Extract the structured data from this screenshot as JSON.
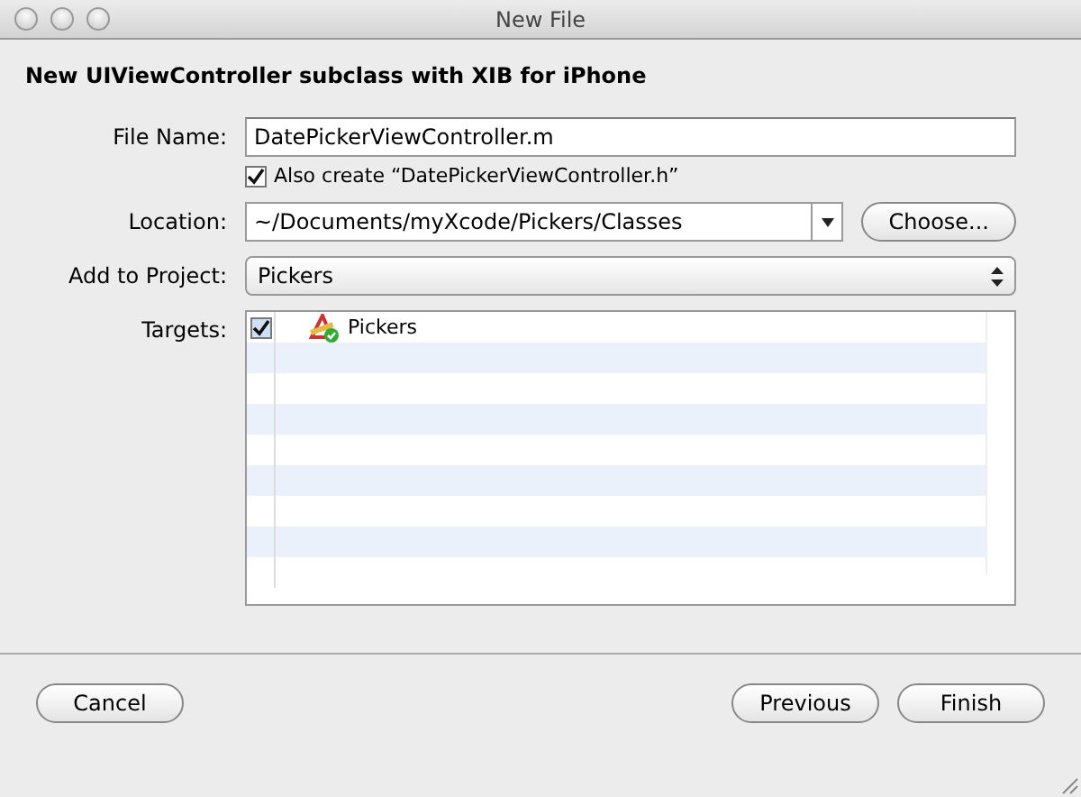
{
  "window": {
    "title": "New File"
  },
  "heading": "New UIViewController subclass with XIB for iPhone",
  "file_name": {
    "label": "File Name:",
    "value": "DatePickerViewController.m"
  },
  "also_create": {
    "label": "Also create “DatePickerViewController.h”",
    "checked": true
  },
  "location": {
    "label": "Location:",
    "value": "~/Documents/myXcode/Pickers/Classes",
    "button": "Choose..."
  },
  "project": {
    "label": "Add to Project:",
    "value": "Pickers"
  },
  "targets": {
    "label": "Targets:",
    "items": [
      {
        "name": "Pickers",
        "checked": true
      }
    ]
  },
  "buttons": {
    "cancel": "Cancel",
    "previous": "Previous",
    "finish": "Finish"
  }
}
